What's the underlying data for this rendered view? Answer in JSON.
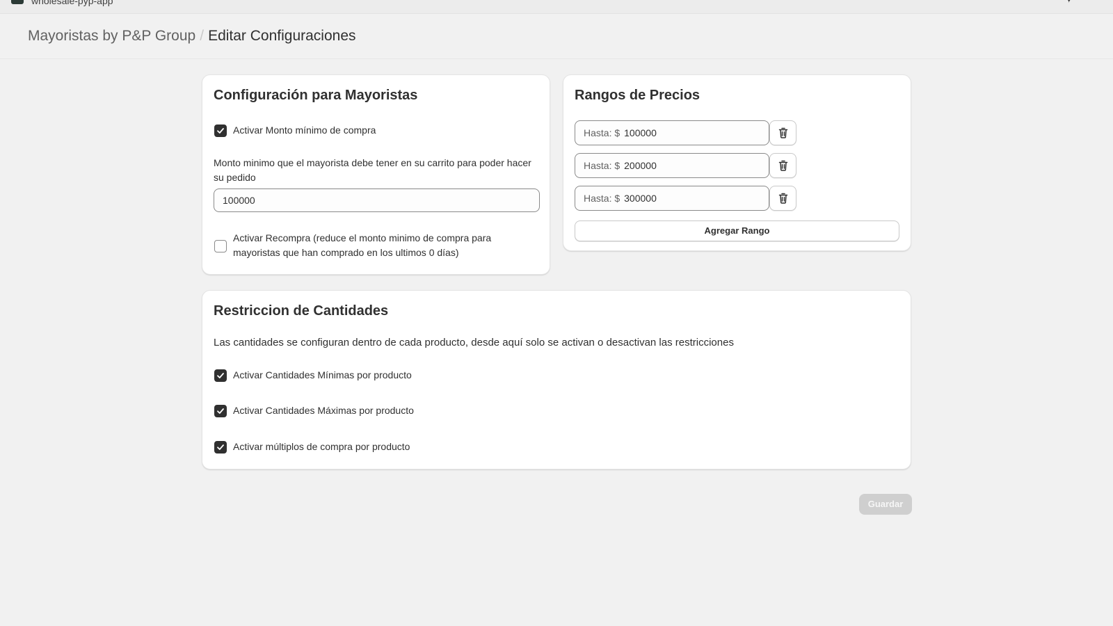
{
  "topbar": {
    "app_name": "wholesale-pyp-app",
    "more_icon": "more-icon"
  },
  "breadcrumb": {
    "parent": "Mayoristas by P&P Group",
    "separator": "/",
    "current": "Editar Configuraciones"
  },
  "wholesale_config": {
    "title": "Configuración para Mayoristas",
    "min_purchase_checkbox": {
      "label": "Activar Monto mínimo de compra",
      "checked": true
    },
    "min_amount_label": "Monto minimo que el mayorista debe tener en su carrito para poder hacer su pedido",
    "min_amount_value": "100000",
    "repurchase_checkbox": {
      "label": "Activar Recompra (reduce el monto minimo de compra para mayoristas que han comprado en los ultimos 0 días)",
      "checked": false
    }
  },
  "price_ranges": {
    "title": "Rangos de Precios",
    "prefix": "Hasta: $",
    "ranges": [
      {
        "value": "100000"
      },
      {
        "value": "200000"
      },
      {
        "value": "300000"
      }
    ],
    "delete_icon": "trash-icon",
    "add_label": "Agregar Rango"
  },
  "quantity_restrictions": {
    "title": "Restriccion de Cantidades",
    "description": "Las cantidades se configuran dentro de cada producto, desde aquí solo se activan o desactivan las restricciones",
    "options": [
      {
        "label": "Activar Cantidades Mínimas por producto",
        "checked": true
      },
      {
        "label": "Activar Cantidades Máximas por producto",
        "checked": true
      },
      {
        "label": "Activar múltiplos de compra por producto",
        "checked": true
      }
    ]
  },
  "actions": {
    "save_label": "Guardar",
    "save_disabled": true
  }
}
